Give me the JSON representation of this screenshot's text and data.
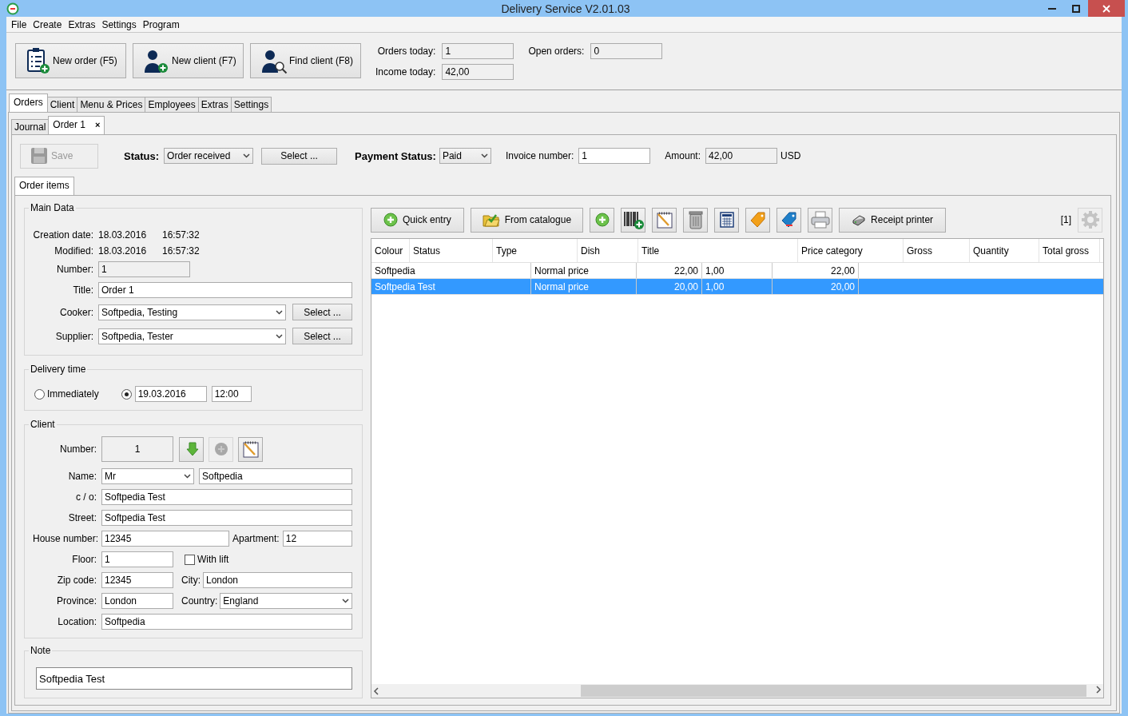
{
  "window": {
    "title": "Delivery Service V2.01.03"
  },
  "menu": [
    "File",
    "Create",
    "Extras",
    "Settings",
    "Program"
  ],
  "toolbar": [
    {
      "label": "New order (F5)"
    },
    {
      "label": "New client (F7)"
    },
    {
      "label": "Find client (F8)"
    }
  ],
  "stats": [
    {
      "label": "Orders today:",
      "value": "1"
    },
    {
      "label": "Open orders:",
      "value": "0"
    },
    {
      "label": "Income today:",
      "value": "42,00"
    }
  ],
  "main_tabs": [
    {
      "label": "Orders",
      "selected": true
    },
    {
      "label": "Client",
      "selected": false
    },
    {
      "label": "Menu & Prices",
      "selected": false
    },
    {
      "label": "Employees",
      "selected": false
    },
    {
      "label": "Extras",
      "selected": false
    },
    {
      "label": "Settings",
      "selected": false
    }
  ],
  "sub_tabs": [
    {
      "label": "Journal",
      "selected": false
    },
    {
      "label": "Order 1",
      "selected": true,
      "close": "×"
    }
  ],
  "order_bar": {
    "save": {
      "label": "Save",
      "disabled": true
    },
    "status": {
      "label": "Status:",
      "value": "Order received"
    },
    "select": "Select ...",
    "payment": {
      "label": "Payment Status:",
      "value": "Paid"
    },
    "invoice": {
      "label": "Invoice number:",
      "value": "1"
    },
    "amount": {
      "label": "Amount:",
      "value": "42,00",
      "unit": "USD",
      "readonly": true
    }
  },
  "inner_tabs": [
    {
      "label": "Order items",
      "selected": true
    }
  ],
  "main_data": {
    "title": "Main Data",
    "dates": [
      {
        "label": "Creation date:",
        "date": "18.03.2016",
        "time": "16:57:32"
      },
      {
        "label": "Modified:",
        "date": "18.03.2016",
        "time": "16:57:32"
      }
    ],
    "number": {
      "label": "Number:",
      "value": "1",
      "readonly": true
    },
    "order_title": {
      "label": "Title:",
      "value": "Order 1"
    },
    "people": [
      {
        "label": "Cooker:",
        "value": "Softpedia, Testing",
        "button": "Select ..."
      },
      {
        "label": "Supplier:",
        "value": "Softpedia, Tester",
        "button": "Select ..."
      }
    ]
  },
  "delivery": {
    "title": "Delivery time",
    "immediately": {
      "label": "Immediately",
      "selected": false
    },
    "scheduled": {
      "selected": true,
      "date": "19.03.2016",
      "time": "12:00"
    }
  },
  "client": {
    "title": "Client",
    "number": {
      "label": "Number:",
      "value": "1",
      "readonly": true
    },
    "add_disabled": true,
    "name": {
      "label": "Name:",
      "salutation": "Mr",
      "value": "Softpedia"
    },
    "co": {
      "label": "c / o:",
      "value": "Softpedia Test"
    },
    "street": {
      "label": "Street:",
      "value": "Softpedia Test"
    },
    "house": {
      "label": "House number:",
      "value": "12345"
    },
    "apartment": {
      "label": "Apartment:",
      "value": "12"
    },
    "floor": {
      "label": "Floor:",
      "value": "1"
    },
    "lift": {
      "label": "With lift",
      "checked": false
    },
    "zip": {
      "label": "Zip code:",
      "value": "12345"
    },
    "city": {
      "label": "City:",
      "value": "London"
    },
    "province": {
      "label": "Province:",
      "value": "London"
    },
    "country": {
      "label": "Country:",
      "value": "England"
    },
    "location": {
      "label": "Location:",
      "value": "Softpedia"
    }
  },
  "note": {
    "title": "Note",
    "value": "Softpedia Test"
  },
  "items_toolbar": [
    {
      "kind": "labeled",
      "label": "Quick entry"
    },
    {
      "kind": "labeled",
      "label": "From catalogue"
    },
    {
      "kind": "icon"
    },
    {
      "kind": "icon"
    },
    {
      "kind": "icon"
    },
    {
      "kind": "icon"
    },
    {
      "kind": "icon"
    },
    {
      "kind": "icon"
    },
    {
      "kind": "icon"
    },
    {
      "kind": "icon"
    },
    {
      "kind": "labeled",
      "label": "Receipt printer"
    }
  ],
  "page_indicator": "[1]",
  "settings_disabled": true,
  "table": {
    "columns": [
      "Colour",
      "Status",
      "Type",
      "Dish",
      "Title",
      "Price category",
      "Gross",
      "Quantity",
      "Total gross"
    ],
    "rows": [
      {
        "selected": false,
        "cells": [
          "Softpedia",
          "Normal price",
          "22,00",
          "1,00",
          "22,00"
        ]
      },
      {
        "selected": true,
        "cells": [
          "Softpedia Test",
          "Normal price",
          "20,00",
          "1,00",
          "20,00"
        ]
      }
    ]
  }
}
